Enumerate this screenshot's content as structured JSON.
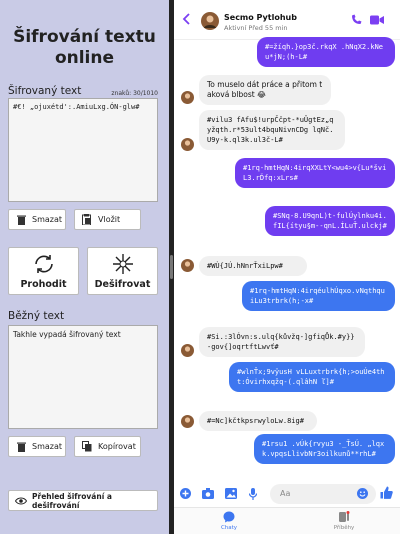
{
  "app": {
    "title": "Šifrování textu online",
    "encrypted_label": "Šifrovaný text",
    "char_counter": "znaků: 30/1010",
    "encrypted_value": "#€! „ojuxétd':.AmiuLxg.ÓN-glw#",
    "clear_button": "Smazat",
    "paste_button": "Vložit",
    "encrypt_button": "Prohodit",
    "decrypt_button": "Dešifrovat",
    "plain_label": "Běžný text",
    "plain_value": "Takhle vypadá šifrovaný text",
    "clear_button_2": "Smazat",
    "copy_button": "Kopírovat",
    "overview_button": "Přehled šifrování a dešifrování"
  },
  "chat": {
    "contact_name": "Secmo Pytlohub",
    "contact_status": "Aktivní Před 55 min",
    "composer_placeholder": "Aa",
    "tab_chats": "Chaty",
    "tab_stories": "Příběhy",
    "messages": [
      {
        "dir": "out",
        "color": "purple",
        "text": "#=žíqh.}op3č.rkqX .hNqX2.kNeu*jN;(h-L#"
      },
      {
        "dir": "in",
        "text": "To muselo dát práce a přitom taková blbost 😂"
      },
      {
        "dir": "in",
        "text": "#vilu3 fAfu$!urpČčpt-*uÛgtEz„q yžqth.r*53ult4bquNivnCDg lqNč.U9y-k.ql3k.ul3č-L#"
      },
      {
        "dir": "out",
        "color": "purple",
        "text": "#1rq-hmtHqN:4irqXXLtY<wu4>v{Lu*šviL3.rĎfq:xLrs#"
      },
      {
        "dir": "out",
        "color": "purple",
        "text": "#SNq-8.U9qnL)t-fulÚylnku4i.fIL{ítyu§m--qnL.ÍLuŤ.ulckj#"
      },
      {
        "dir": "in",
        "text": "#WÙ{JÚ.hNnrŤxiLpw#"
      },
      {
        "dir": "out",
        "color": "blue",
        "text": "#1rq-hmtHqN:4irqéulhÚqxo.vNqthquiLu3trbrk(h;-x#"
      },
      {
        "dir": "in",
        "text": "#Si.:3lÓvn:s.ulq{kůvžq-]gfiqŮk.#y}}-gov{]oqrtftLwvť#"
      },
      {
        "dir": "out",
        "color": "blue",
        "text": "#wlnŤx;9vÿusH vLLuxtrbrk{h;>ouÚe4tht:Óvirhxqžq-(.qlâhN  ľ]#"
      },
      {
        "dir": "in",
        "text": "#=Nc]kčtkpsrwyloLw.8ig#"
      },
      {
        "dir": "out",
        "color": "blue",
        "text": "#1rsu1 .vÚk{rvyu3 -_ŤsÚ. „lqxk.vpqsLlivbNr3oilkunů**rhL#"
      }
    ]
  }
}
